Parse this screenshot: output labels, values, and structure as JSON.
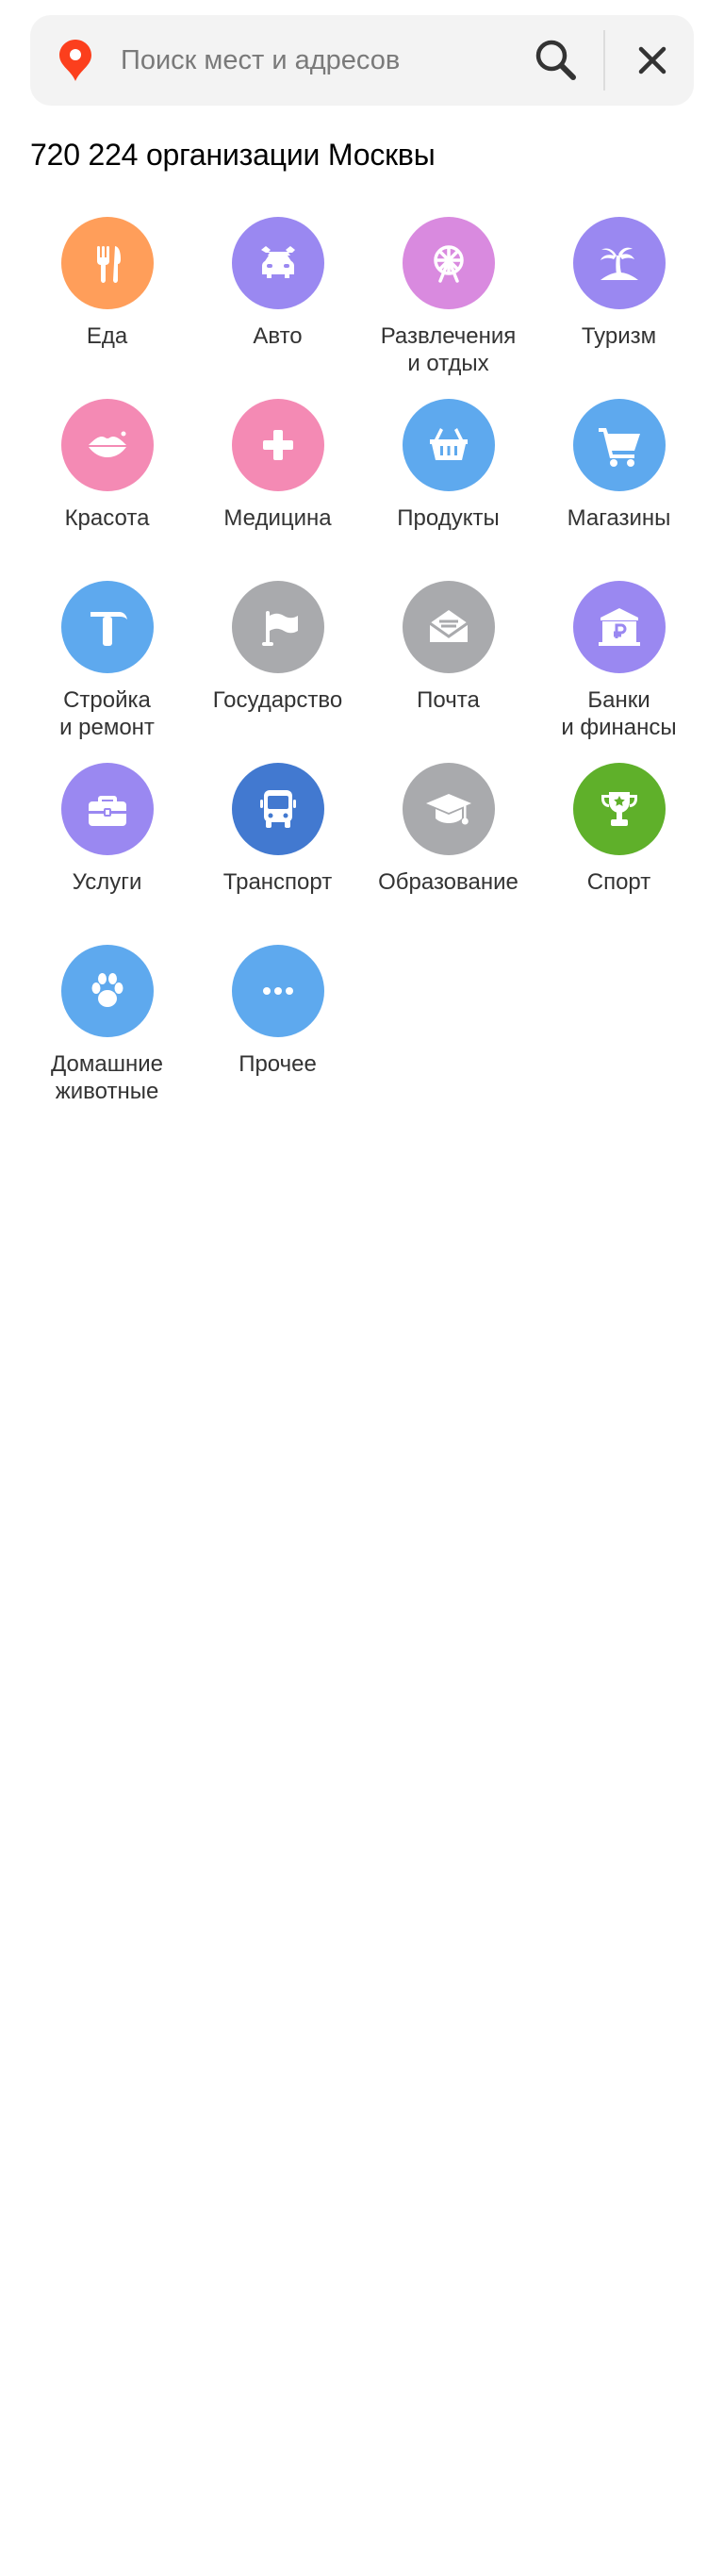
{
  "search": {
    "placeholder": "Поиск мест и адресов",
    "value": ""
  },
  "headline": "720 224 организации Москвы",
  "categories": [
    {
      "label": "Еда",
      "icon": "fork-knife-icon",
      "color": "#ff9e5a"
    },
    {
      "label": "Авто",
      "icon": "car-wrench-icon",
      "color": "#9a88f1"
    },
    {
      "label": "Развлечения\nи отдых",
      "icon": "ferris-wheel-icon",
      "color": "#d98adf"
    },
    {
      "label": "Туризм",
      "icon": "palm-tree-icon",
      "color": "#9a88f1"
    },
    {
      "label": "Красота",
      "icon": "lips-icon",
      "color": "#f48ab4"
    },
    {
      "label": "Медицина",
      "icon": "medical-cross-icon",
      "color": "#f48ab4"
    },
    {
      "label": "Продукты",
      "icon": "basket-icon",
      "color": "#5ea9ee"
    },
    {
      "label": "Магазины",
      "icon": "cart-icon",
      "color": "#5ea9ee"
    },
    {
      "label": "Стройка\nи ремонт",
      "icon": "hammer-icon",
      "color": "#5ea9ee"
    },
    {
      "label": "Государство",
      "icon": "flag-icon",
      "color": "#a9aaad"
    },
    {
      "label": "Почта",
      "icon": "envelope-icon",
      "color": "#a9aaad"
    },
    {
      "label": "Банки\nи финансы",
      "icon": "bank-ruble-icon",
      "color": "#9a88f1"
    },
    {
      "label": "Услуги",
      "icon": "briefcase-icon",
      "color": "#9a88f1"
    },
    {
      "label": "Транспорт",
      "icon": "bus-icon",
      "color": "#4279d0"
    },
    {
      "label": "Образование",
      "icon": "graduation-cap-icon",
      "color": "#a9aaad"
    },
    {
      "label": "Спорт",
      "icon": "trophy-icon",
      "color": "#5fb02a"
    },
    {
      "label": "Домашние\nживотные",
      "icon": "paw-icon",
      "color": "#5ea9ee"
    },
    {
      "label": "Прочее",
      "icon": "more-dots-icon",
      "color": "#5ea9ee"
    }
  ]
}
